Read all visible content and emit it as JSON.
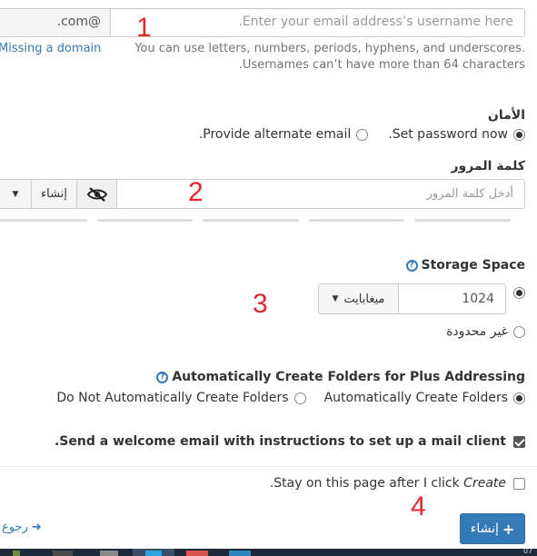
{
  "email": {
    "domain_suffix": ".com@",
    "username_placeholder": ".Enter your email address’s username here",
    "missing_domain_link": "Missing a domain",
    "help_line1": "You can use letters, numbers, periods, hyphens, and underscores.",
    "help_line2": ".Usernames can’t have more than 64 characters"
  },
  "security": {
    "heading": "الأمان",
    "option_set_password": ".Set password now",
    "option_alternate_email": ".Provide alternate email",
    "selected": "set_password"
  },
  "password": {
    "label": "كلمة المرور",
    "placeholder": "أدخل كلمة المرور",
    "generate_label": "إنشاء",
    "toggle_icon": "eye-slash-icon",
    "dropdown_icon": "caret-down-icon"
  },
  "storage": {
    "heading": "Storage Space",
    "quota_value": "1024",
    "unit_label": "ميغابايت",
    "unlimited_label": "غير محدودة",
    "selected": "quota"
  },
  "plus_addressing": {
    "heading": "Automatically Create Folders for Plus Addressing",
    "option_auto": "Automatically Create Folders",
    "option_no_auto": "Do Not Automatically Create Folders",
    "selected": "auto"
  },
  "welcome_email": {
    "label": ".Send a welcome email with instructions to set up a mail client",
    "checked": true
  },
  "stay_on_page": {
    "label_prefix": ".Stay on this page after I click ",
    "label_emphasis": "Create",
    "checked": false
  },
  "actions": {
    "create_label": "إنشاء",
    "back_label": "رجوع"
  },
  "annotations": [
    "1",
    "2",
    "3",
    "4"
  ],
  "taskbar": {
    "clock_fragment": "07"
  },
  "colors": {
    "primary": "#337ab7",
    "annotation_red": "#e0282d"
  }
}
